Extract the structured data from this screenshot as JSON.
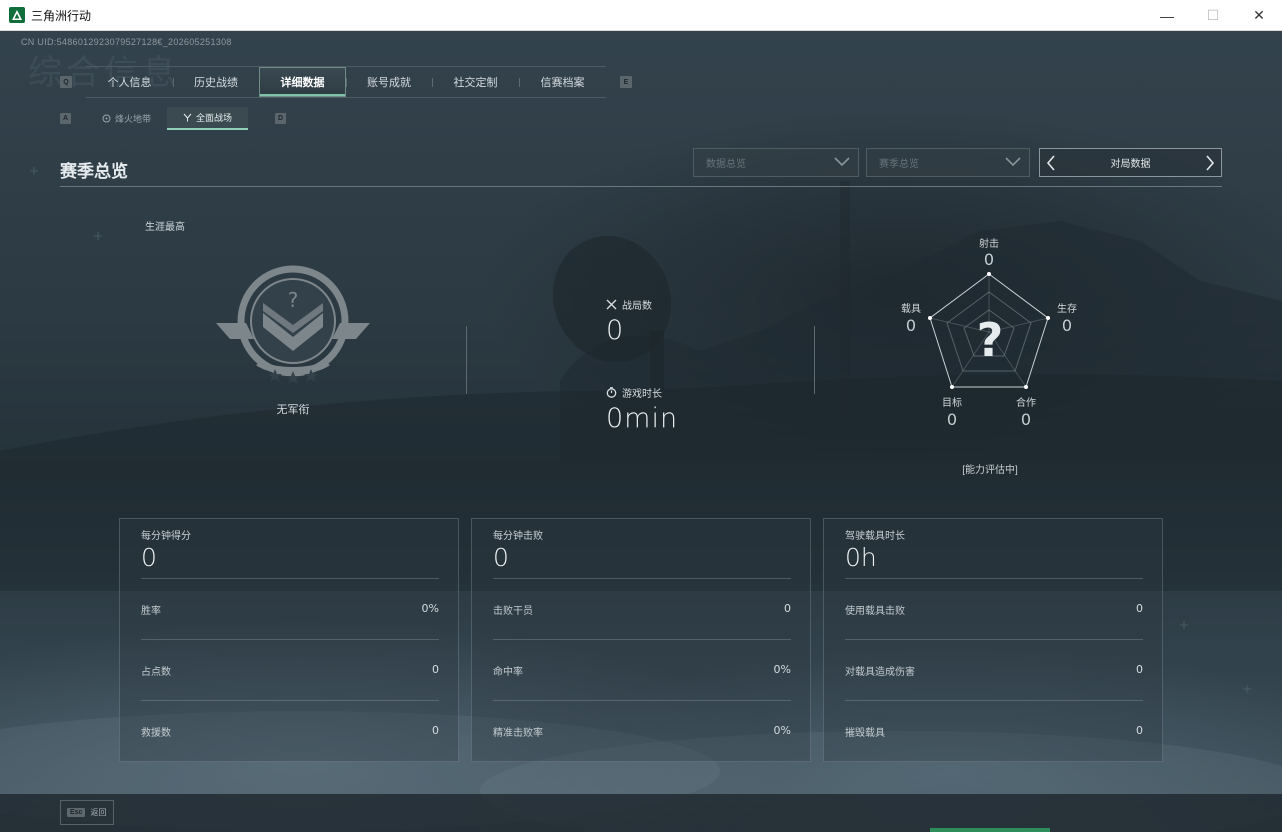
{
  "window": {
    "title": "三角洲行动",
    "minimize": "—",
    "maximize": "☐",
    "close": "✕"
  },
  "header": {
    "uid": "CN UID:5486012923079527128€_202605251308",
    "ghost_title": "综合信息",
    "main_tabs_prev_key": "Q",
    "main_tabs_next_key": "E",
    "sub_tabs_prev_key": "A",
    "sub_tabs_next_key": "D",
    "main_tabs": [
      {
        "label": "个人信息"
      },
      {
        "label": "历史战绩"
      },
      {
        "label": "详细数据",
        "active": true
      },
      {
        "label": "账号成就"
      },
      {
        "label": "社交定制"
      },
      {
        "label": "信赛档案"
      }
    ],
    "sub_tabs": [
      {
        "label": "烽火地带"
      },
      {
        "label": "全面战场",
        "active": true
      }
    ]
  },
  "section": {
    "title": "赛季总览",
    "dropdown1": "数据总览",
    "dropdown2": "赛季总览",
    "pager_label": "对局数据"
  },
  "overview": {
    "career_label": "生涯最高",
    "rank_name": "无军衔",
    "matches_label": "战局数",
    "matches_value": "0",
    "playtime_label": "游戏时长",
    "playtime_value": "0min"
  },
  "radar": {
    "axes": [
      {
        "label": "射击",
        "value": "0"
      },
      {
        "label": "生存",
        "value": "0"
      },
      {
        "label": "合作",
        "value": "0"
      },
      {
        "label": "目标",
        "value": "0"
      },
      {
        "label": "载具",
        "value": "0"
      }
    ],
    "status": "[能力评估中]"
  },
  "cards": [
    {
      "title": "每分钟得分",
      "value": "0",
      "rows": [
        {
          "label": "胜率",
          "value": "0%"
        },
        {
          "label": "占点数",
          "value": "0"
        },
        {
          "label": "救援数",
          "value": "0"
        }
      ]
    },
    {
      "title": "每分钟击败",
      "value": "0",
      "rows": [
        {
          "label": "击败干员",
          "value": "0"
        },
        {
          "label": "命中率",
          "value": "0%"
        },
        {
          "label": "精准击败率",
          "value": "0%"
        }
      ]
    },
    {
      "title": "驾驶载具时长",
      "value": "0h",
      "rows": [
        {
          "label": "使用载具击败",
          "value": "0"
        },
        {
          "label": "对载具造成伤害",
          "value": "0"
        },
        {
          "label": "摧毁载具",
          "value": "0"
        }
      ]
    }
  ],
  "footer": {
    "esc_key": "Esc",
    "back_label": "返回"
  },
  "colors": {
    "accent": "#7fc4a8",
    "panel_border": "#6b777e"
  }
}
